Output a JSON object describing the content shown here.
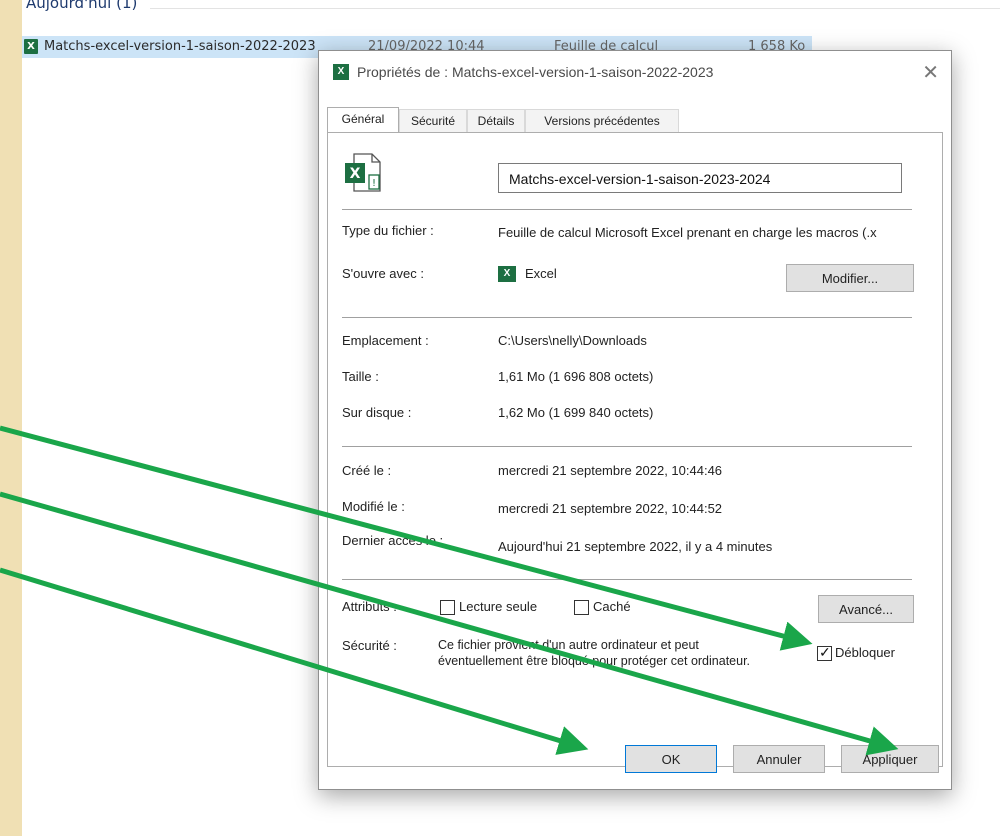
{
  "explorer": {
    "group_header": "Aujourd'hui (1)",
    "file": {
      "name": "Matchs-excel-version-1-saison-2022-2023",
      "date": "21/09/2022 10:44",
      "type": "Feuille de calcul",
      "size": "1 658 Ko"
    }
  },
  "dialog": {
    "title": "Propriétés de : Matchs-excel-version-1-saison-2022-2023",
    "tabs": [
      "Général",
      "Sécurité",
      "Détails",
      "Versions précédentes"
    ],
    "filename": "Matchs-excel-version-1-saison-2023-2024",
    "type_label": "Type du fichier :",
    "type_value": "Feuille de calcul Microsoft Excel prenant en charge les macros (.x",
    "opens_label": "S'ouvre avec :",
    "opens_value": "Excel",
    "modify_button": "Modifier...",
    "location_label": "Emplacement :",
    "location_value": "C:\\Users\\nelly\\Downloads",
    "size_label": "Taille :",
    "size_value": "1,61 Mo (1 696 808 octets)",
    "disk_label": "Sur disque :",
    "disk_value": "1,62 Mo (1 699 840 octets)",
    "created_label": "Créé le :",
    "created_value": "mercredi 21 septembre 2022, 10:44:46",
    "modified_label": "Modifié le :",
    "modified_value": "mercredi 21 septembre 2022, 10:44:52",
    "accessed_label": "Dernier accès le :",
    "accessed_value": "Aujourd'hui 21 septembre 2022, il y a 4 minutes",
    "attributes_label": "Attributs :",
    "readonly_label": "Lecture seule",
    "hidden_label": "Caché",
    "advanced_button": "Avancé...",
    "security_label": "Sécurité :",
    "security_line1": "Ce fichier provient d'un autre ordinateur et peut",
    "security_line2": "éventuellement être bloqué pour protéger cet ordinateur.",
    "unblock_label": "Débloquer",
    "unblock_checked": true,
    "ok_button": "OK",
    "cancel_button": "Annuler",
    "apply_button": "Appliquer"
  },
  "colors": {
    "arrow": "#1aa64a",
    "excel_green": "#1d6f42",
    "selection": "#cce4f7"
  }
}
